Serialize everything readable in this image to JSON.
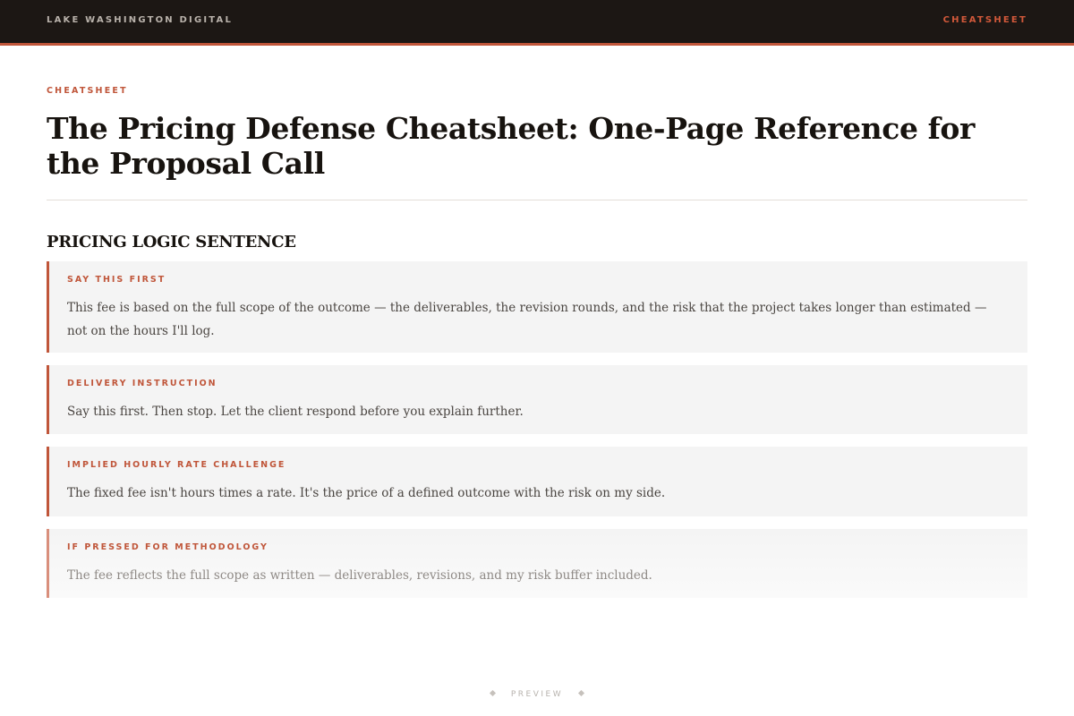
{
  "header": {
    "brand": "LAKE WASHINGTON DIGITAL",
    "nav_link": "CHEATSHEET"
  },
  "page": {
    "eyebrow": "CHEATSHEET",
    "title": "The Pricing Defense Cheatsheet: One-Page Reference for the Proposal Call",
    "section_title": "PRICING LOGIC SENTENCE"
  },
  "cards": [
    {
      "label": "SAY THIS FIRST",
      "text": "This fee is based on the full scope of the outcome — the deliverables, the revision rounds, and the risk that the project takes longer than estimated — not on the hours I'll log."
    },
    {
      "label": "DELIVERY INSTRUCTION",
      "text": "Say this first. Then stop. Let the client respond before you explain further."
    },
    {
      "label": "IMPLIED HOURLY RATE CHALLENGE",
      "text": "The fixed fee isn't hours times a rate. It's the price of a defined outcome with the risk on my side."
    },
    {
      "label": "IF PRESSED FOR METHODOLOGY",
      "text": "The fee reflects the full scope as written — deliverables, revisions, and my risk buffer included."
    }
  ],
  "footer": {
    "label": "PREVIEW"
  },
  "colors": {
    "topbar": "#1c1714",
    "accent": "#c0563a",
    "card_bg": "#f4f4f4"
  }
}
